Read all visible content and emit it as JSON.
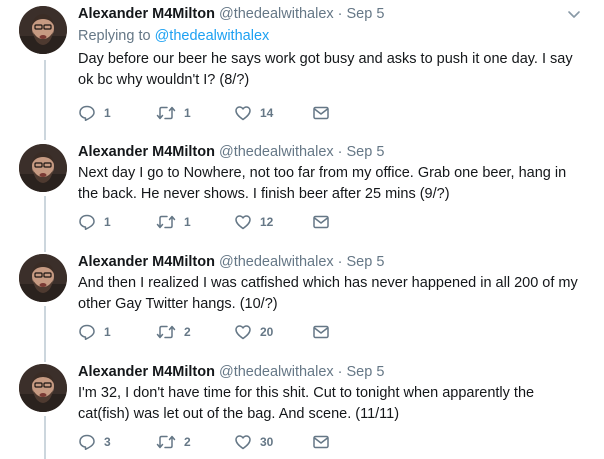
{
  "tweets": [
    {
      "name": "Alexander M4Milton",
      "handle": "@thedealwithalex",
      "dot": "·",
      "time": "Sep 5",
      "replying_prefix": "Replying to ",
      "replying_to": "@thedealwithalex",
      "text": "Day before our beer he says work got busy and asks to push it one day. I say ok bc why wouldn't I? (8/?)",
      "replies": "1",
      "retweets": "1",
      "likes": "14"
    },
    {
      "name": "Alexander M4Milton",
      "handle": "@thedealwithalex",
      "dot": "·",
      "time": "Sep 5",
      "text": "Next day I go to Nowhere, not too far from my office. Grab one beer, hang in the back. He never shows. I finish beer after 25 mins (9/?)",
      "replies": "1",
      "retweets": "1",
      "likes": "12"
    },
    {
      "name": "Alexander M4Milton",
      "handle": "@thedealwithalex",
      "dot": "·",
      "time": "Sep 5",
      "text": "And then I realized I was catfished which has never happened in all 200 of my other Gay Twitter hangs. (10/?)",
      "replies": "1",
      "retweets": "2",
      "likes": "20"
    },
    {
      "name": "Alexander M4Milton",
      "handle": "@thedealwithalex",
      "dot": "·",
      "time": "Sep 5",
      "text": "I'm 32, I don't have time for this shit. Cut to tonight when apparently the cat(fish) was let out of the bag. And scene. (11/11)",
      "replies": "3",
      "retweets": "2",
      "likes": "30"
    }
  ],
  "icons": {
    "avatar": "avatar",
    "caret": "chevron-down-icon",
    "reply": "reply-icon",
    "retweet": "retweet-icon",
    "like": "heart-icon",
    "dm": "envelope-icon"
  },
  "colors": {
    "text": "#14171a",
    "muted": "#657786",
    "link": "#1da1f2",
    "thread_line": "#ccd6dd"
  }
}
